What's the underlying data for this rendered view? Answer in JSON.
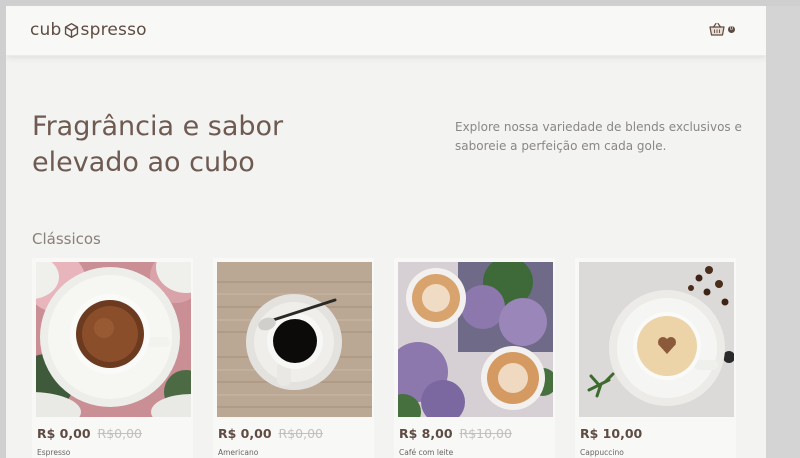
{
  "header": {
    "logo_left": "cub",
    "logo_right": "spresso",
    "cart_count": "0"
  },
  "hero": {
    "title_line1": "Fragrância e sabor",
    "title_line2": "elevado ao cubo",
    "description": "Explore nossa variedade de blends exclusivos e saboreie a perfeição em cada gole."
  },
  "section": {
    "title": "Clássicos"
  },
  "products": [
    {
      "price": "R$ 0,00",
      "old_price": "R$0,00",
      "name": "Espresso"
    },
    {
      "price": "R$ 0,00",
      "old_price": "R$0,00",
      "name": "Americano"
    },
    {
      "price": "R$ 8,00",
      "old_price": "R$10,00",
      "name": "Café com leite"
    },
    {
      "price": "R$ 10,00",
      "old_price": "",
      "name": "Cappuccino"
    }
  ],
  "colors": {
    "brand": "#5e4b42",
    "background": "#f3f3f1",
    "muted_text": "#8a8784"
  }
}
